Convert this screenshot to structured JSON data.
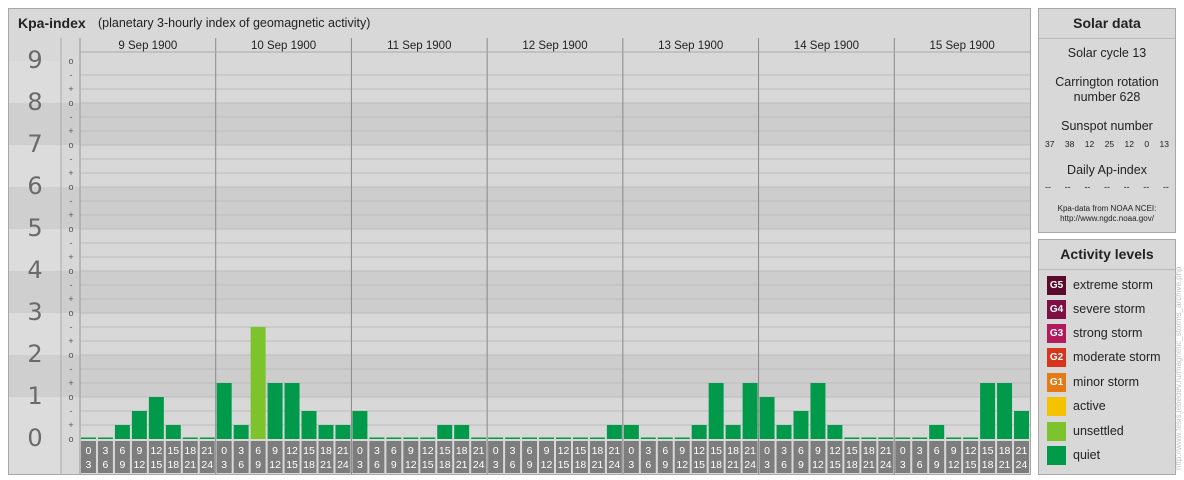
{
  "title": "Kpa-index",
  "subtitle": "(planetary 3-hourly index of geomagnetic activity)",
  "chart_data": {
    "type": "bar",
    "title": "Kpa-index",
    "subtitle": "(planetary 3-hourly index of geomagnetic activity)",
    "ylim": [
      0,
      9
    ],
    "y_major_ticks": [
      "0",
      "1",
      "2",
      "3",
      "4",
      "5",
      "6",
      "7",
      "8",
      "9"
    ],
    "y_minor_ticks": [
      "o",
      "+",
      "-"
    ],
    "days": [
      "9 Sep 1900",
      "10 Sep 1900",
      "11 Sep 1900",
      "12 Sep 1900",
      "13 Sep 1900",
      "14 Sep 1900",
      "15 Sep 1900"
    ],
    "interval_start_labels": [
      "0",
      "3",
      "6",
      "9",
      "12",
      "15",
      "18",
      "21"
    ],
    "interval_end_labels": [
      "3",
      "6",
      "9",
      "12",
      "15",
      "18",
      "21",
      "24"
    ],
    "values": [
      [
        0.0,
        0.0,
        0.333,
        0.667,
        1.0,
        0.333,
        0.0,
        0.0
      ],
      [
        1.333,
        0.333,
        2.667,
        1.333,
        1.333,
        0.667,
        0.333,
        0.333
      ],
      [
        0.667,
        0.0,
        0.0,
        0.0,
        0.0,
        0.333,
        0.333,
        0.0
      ],
      [
        0.0,
        0.0,
        0.0,
        0.0,
        0.0,
        0.0,
        0.0,
        0.333
      ],
      [
        0.333,
        0.0,
        0.0,
        0.0,
        0.333,
        1.333,
        0.333,
        1.333
      ],
      [
        1.0,
        0.333,
        0.667,
        1.333,
        0.333,
        0.0,
        0.0,
        0.0
      ],
      [
        0.0,
        0.0,
        0.333,
        0.0,
        0.0,
        1.333,
        1.333,
        0.667
      ]
    ],
    "bar_colors": {
      "quiet": "#009a4a",
      "unsettled": "#7dc32b"
    }
  },
  "solar": {
    "heading": "Solar data",
    "cycle": "Solar cycle 13",
    "carrington_line1": "Carrington rotation",
    "carrington_line2": "number 628",
    "sunspot_heading": "Sunspot number",
    "sunspots": [
      "37",
      "38",
      "12",
      "25",
      "12",
      "0",
      "13"
    ],
    "ap_heading": "Daily Ap-index",
    "ap_values": [
      "--",
      "--",
      "--",
      "--",
      "--",
      "--",
      "--"
    ],
    "credit_line1": "Kpa-data from NOAA NCEI:",
    "credit_line2": "http://www.ngdc.noaa.gov/"
  },
  "activity": {
    "heading": "Activity levels",
    "levels": [
      {
        "code": "G5",
        "label": "extreme storm",
        "color": "#5a0a2a"
      },
      {
        "code": "G4",
        "label": "severe storm",
        "color": "#7e1045"
      },
      {
        "code": "G3",
        "label": "strong storm",
        "color": "#b31a5c"
      },
      {
        "code": "G2",
        "label": "moderate storm",
        "color": "#d6361c"
      },
      {
        "code": "G1",
        "label": "minor storm",
        "color": "#e57a14"
      },
      {
        "code": "",
        "label": "active",
        "color": "#f5c200"
      },
      {
        "code": "",
        "label": "unsettled",
        "color": "#7dc32b"
      },
      {
        "code": "",
        "label": "quiet",
        "color": "#009a4a"
      }
    ]
  },
  "watermark": "http://www.tesis.lebedev.ru/magnetic_storms_archive.php"
}
